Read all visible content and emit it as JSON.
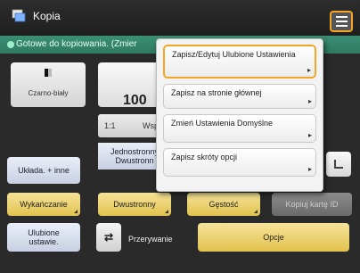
{
  "header": {
    "title": "Kopia",
    "menu_icon": "hamburger-menu-icon"
  },
  "status": {
    "text": "Gotowe do kopiowania. (Zmier"
  },
  "main": {
    "color_label": "Czarno-biały",
    "percent": "100",
    "ratio": "1:1",
    "wsp_fragment": "Wsp",
    "uklad": "Układa. + inne",
    "jednostronny": "Jednostronny\nDwustronn",
    "wykanczanie": "Wykańczanie",
    "dwustronny": "Dwustronny",
    "gestosc": "Gęstość",
    "kopiuj_karte": "Kopiuj kartę ID",
    "ulubione": "Ulubione\nustawie.",
    "przerywanie": "Przerywanie",
    "opcje": "Opcje"
  },
  "dropdown": {
    "items": [
      {
        "label": "Zapisz/Edytuj Ulubione Ustawienia",
        "selected": true
      },
      {
        "label": "Zapisz na stronie głównej",
        "selected": false
      },
      {
        "label": "Zmień Ustawienia Domyślne",
        "selected": false
      },
      {
        "label": "Zapisz skróty opcji",
        "selected": false
      }
    ]
  },
  "colors": {
    "accent": "#f2a623",
    "status_bar": "#2e7a62",
    "yellow_button": "#e2c24e"
  }
}
